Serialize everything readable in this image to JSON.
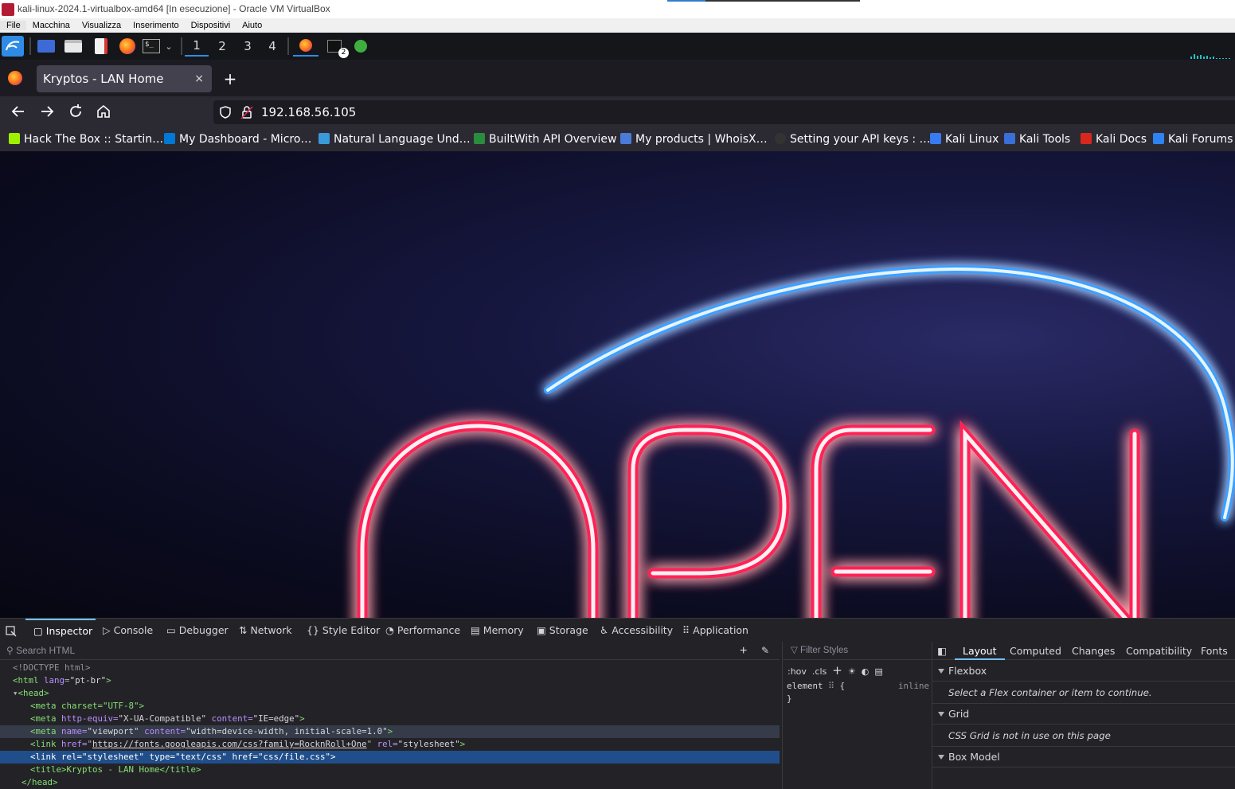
{
  "window": {
    "title": "kali-linux-2024.1-virtualbox-amd64 [In esecuzione] - Oracle VM VirtualBox"
  },
  "vbox_menu": [
    "File",
    "Macchina",
    "Visualizza",
    "Inserimento",
    "Dispositivi",
    "Aiuto"
  ],
  "panel": {
    "workspaces": [
      "1",
      "2",
      "3",
      "4"
    ],
    "active_workspace": "1",
    "terminal_badge": "2"
  },
  "browser": {
    "tab_title": "Kryptos - LAN Home",
    "close_glyph": "×",
    "new_tab_glyph": "+",
    "url": "192.168.56.105",
    "bookmarks": [
      {
        "label": "Hack The Box :: Startin…",
        "color": "#9fef00"
      },
      {
        "label": "My Dashboard - Micro…",
        "color": "#0078d4"
      },
      {
        "label": "Natural Language Und…",
        "color": "#3a9ad9"
      },
      {
        "label": "BuiltWith API Overview",
        "color": "#2a8c3e"
      },
      {
        "label": "My products | WhoisX…",
        "color": "#4a7bd6"
      },
      {
        "label": "Setting your API keys : …",
        "color": "#333333"
      },
      {
        "label": "Kali Linux",
        "color": "#367bf0"
      },
      {
        "label": "Kali Tools",
        "color": "#3a6fd8"
      },
      {
        "label": "Kali Docs",
        "color": "#d8281e"
      },
      {
        "label": "Kali Forums",
        "color": "#2e83f0"
      }
    ],
    "page_sign_text": "OPEN"
  },
  "devtools": {
    "tabs": [
      "Inspector",
      "Console",
      "Debugger",
      "Network",
      "Style Editor",
      "Performance",
      "Memory",
      "Storage",
      "Accessibility",
      "Application"
    ],
    "selected_tab": "Inspector",
    "search_placeholder": "Search HTML",
    "filter_placeholder": "Filter Styles",
    "style_buttons": {
      "hov": ":hov",
      "cls": ".cls"
    },
    "element_rule": "element",
    "element_rule_open": "{",
    "element_rule_close": "}",
    "element_rule_source": "inline",
    "layout_tabs": [
      "Layout",
      "Computed",
      "Changes",
      "Compatibility",
      "Fonts"
    ],
    "sections": [
      {
        "title": "Flexbox",
        "note": "Select a Flex container or item to continue."
      },
      {
        "title": "Grid",
        "note": "CSS Grid is not in use on this page"
      },
      {
        "title": "Box Model",
        "note": ""
      }
    ],
    "source": {
      "doctype": "<!DOCTYPE html>",
      "html_open": "<html",
      "html_lang_attr": "lang",
      "html_lang_val": "\"pt-br\"",
      "head_open": "<head>",
      "meta_charset": "<meta charset=\"UTF-8\">",
      "meta_compat_attr1": "http-equiv=",
      "meta_compat_val1": "\"X-UA-Compatible\"",
      "meta_compat_attr2": "content=",
      "meta_compat_val2": "\"IE=edge\"",
      "meta_viewport_attr1": "name=",
      "meta_viewport_val1": "\"viewport\"",
      "meta_viewport_attr2": "content=",
      "meta_viewport_val2": "\"width=device-width, initial-scale=1.0\"",
      "link_fonts_href": "https://fonts.googleapis.com/css?family=RocknRoll+One",
      "link_fonts_rel": "\"stylesheet\"",
      "link_css": "<link rel=\"stylesheet\" type=\"text/css\" href=\"css/file.css\">",
      "title_line": "<title>Kryptos - LAN Home</title>",
      "head_close": "</head>"
    }
  }
}
